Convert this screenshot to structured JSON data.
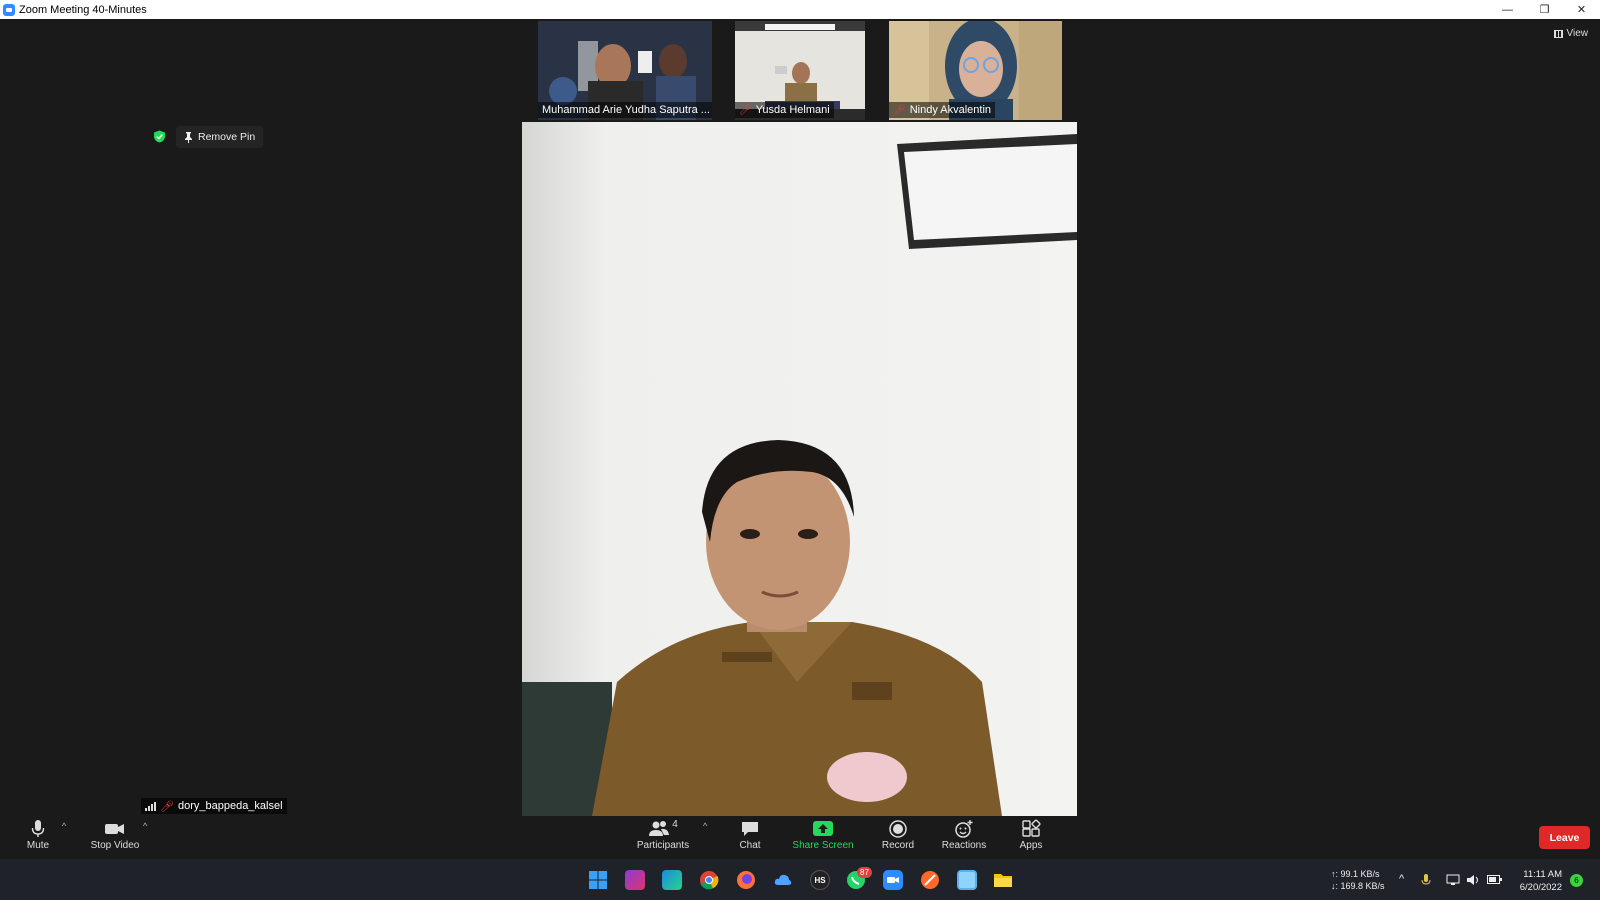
{
  "window": {
    "title": "Zoom Meeting 40-Minutes",
    "controls": {
      "minimize": "—",
      "restore": "❐",
      "close": "✕"
    }
  },
  "view_button": {
    "label": "View",
    "icon": "grid-icon"
  },
  "pin": {
    "label": "Remove Pin",
    "icon": "pin-icon",
    "security_icon": "shield-check-icon"
  },
  "participants_strip": [
    {
      "name": "Muhammad Arie Yudha Saputra ...",
      "muted": false
    },
    {
      "name": "Yusda Helmani",
      "muted": true
    },
    {
      "name": "Nindy Akvalentin",
      "muted": true
    }
  ],
  "self_view": {
    "name": "dory_bappeda_kalsel",
    "muted": true
  },
  "toolbar": {
    "mute": "Mute",
    "stop_video": "Stop Video",
    "participants": "Participants",
    "participants_count": "4",
    "chat": "Chat",
    "share_screen": "Share Screen",
    "record": "Record",
    "reactions": "Reactions",
    "apps": "Apps",
    "leave": "Leave",
    "caret": "^"
  },
  "taskbar": {
    "apps": [
      "windows-start",
      "phpstorm",
      "webstorm",
      "chrome",
      "firefox",
      "cloud-app",
      "hs-app",
      "whatsapp",
      "zoom",
      "arc-app",
      "image-viewer",
      "file-explorer"
    ],
    "whatsapp_badge": "87",
    "net_up": "↑: 99.1 KB/s",
    "net_down": "↓: 169.8 KB/s",
    "time": "11:11 AM",
    "date": "6/20/2022",
    "notification_count": "6",
    "tray_chevron": "^"
  },
  "colors": {
    "accent_green": "#23d959",
    "leave_red": "#e02828",
    "muted_red": "#e0423f",
    "zoom_blue": "#2d8cff"
  }
}
